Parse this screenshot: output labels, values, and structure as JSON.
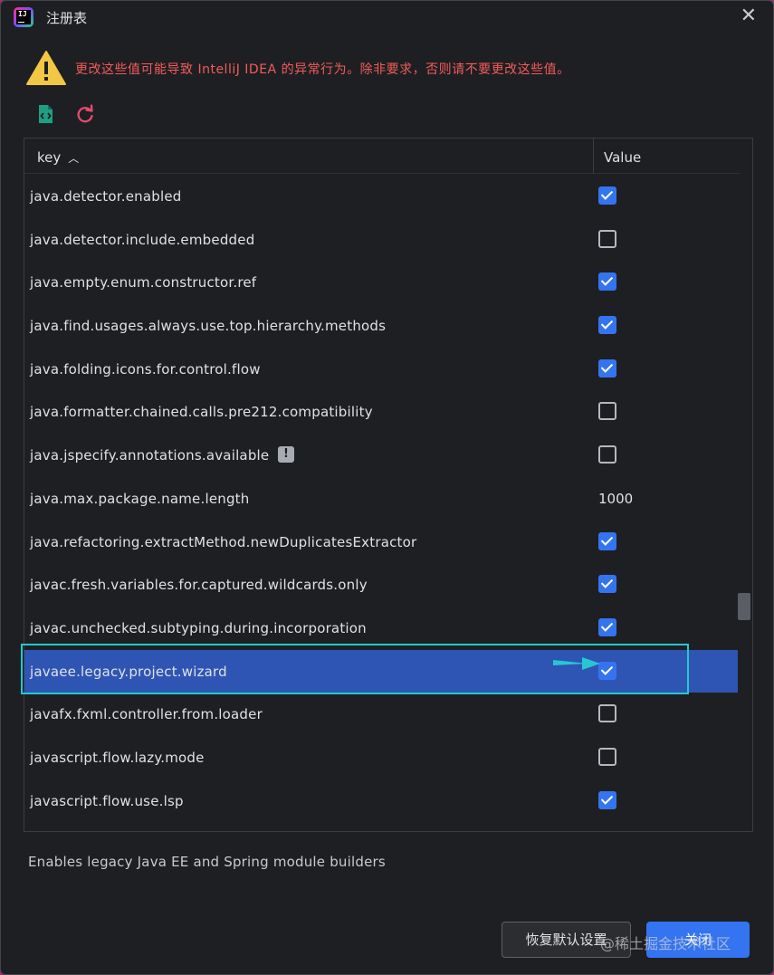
{
  "window": {
    "title": "注册表",
    "app_icon_text": "IJ"
  },
  "warning": {
    "icon": "warning-triangle-icon",
    "text": "更改这些值可能导致 IntelliJ IDEA 的异常行为。除非要求，否则请不要更改这些值。",
    "color": "#f25b5b"
  },
  "toolbar": {
    "export_icon": "export-file-icon",
    "reset_icon": "reset-refresh-icon"
  },
  "table": {
    "columns": {
      "key": "key",
      "key_sort": "ascending",
      "value": "Value"
    },
    "rows": [
      {
        "key": "java.detector.enabled",
        "type": "bool",
        "value": true
      },
      {
        "key": "java.detector.include.embedded",
        "type": "bool",
        "value": false
      },
      {
        "key": "java.empty.enum.constructor.ref",
        "type": "bool",
        "value": true
      },
      {
        "key": "java.find.usages.always.use.top.hierarchy.methods",
        "type": "bool",
        "value": true
      },
      {
        "key": "java.folding.icons.for.control.flow",
        "type": "bool",
        "value": true
      },
      {
        "key": "java.formatter.chained.calls.pre212.compatibility",
        "type": "bool",
        "value": false
      },
      {
        "key": "java.jspecify.annotations.available",
        "type": "bool",
        "value": false,
        "badge": "!"
      },
      {
        "key": "java.max.package.name.length",
        "type": "text",
        "value": "1000"
      },
      {
        "key": "java.refactoring.extractMethod.newDuplicatesExtractor",
        "type": "bool",
        "value": true
      },
      {
        "key": "javac.fresh.variables.for.captured.wildcards.only",
        "type": "bool",
        "value": true
      },
      {
        "key": "javac.unchecked.subtyping.during.incorporation",
        "type": "bool",
        "value": true
      },
      {
        "key": "javaee.legacy.project.wizard",
        "type": "bool",
        "value": true,
        "selected": true
      },
      {
        "key": "javafx.fxml.controller.from.loader",
        "type": "bool",
        "value": false
      },
      {
        "key": "javascript.flow.lazy.mode",
        "type": "bool",
        "value": false
      },
      {
        "key": "javascript.flow.use.lsp",
        "type": "bool",
        "value": true
      }
    ]
  },
  "description": "Enables legacy Java EE and Spring module builders",
  "buttons": {
    "restore_defaults": "恢复默认设置",
    "close": "关闭"
  },
  "watermark": "@稀土掘金技术社区",
  "colors": {
    "background": "#1e1f22",
    "selection": "#2e55b4",
    "checkbox_on": "#3574f0",
    "annotation": "#27c7d2"
  }
}
